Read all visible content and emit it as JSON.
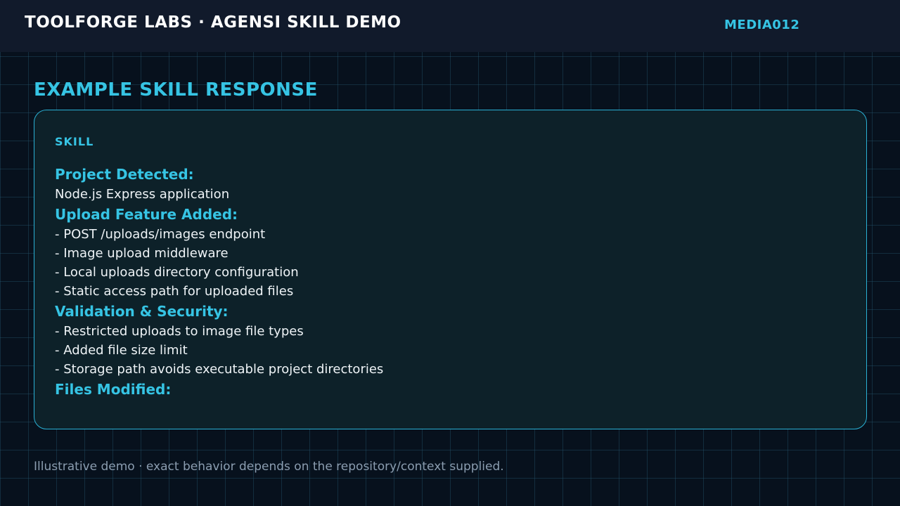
{
  "header": {
    "title": "TOOLFORGE LABS · AGENSI SKILL DEMO",
    "code": "MEDIA012"
  },
  "section": {
    "heading": "EXAMPLE SKILL RESPONSE"
  },
  "card": {
    "label": "SKILL",
    "blocks": [
      {
        "heading": "Project Detected:",
        "lines": [
          "Node.js Express application"
        ]
      },
      {
        "heading": "Upload Feature Added:",
        "lines": [
          "- POST /uploads/images endpoint",
          "- Image upload middleware",
          "- Local uploads directory configuration",
          "- Static access path for uploaded files"
        ]
      },
      {
        "heading": "Validation & Security:",
        "lines": [
          "- Restricted uploads to image file types",
          "- Added file size limit",
          "- Storage path avoids executable project directories"
        ]
      },
      {
        "heading": "Files Modified:",
        "lines": []
      }
    ]
  },
  "footer": {
    "note": "Illustrative demo · exact behavior depends on the repository/context supplied."
  },
  "colors": {
    "background": "#07111d",
    "topbar": "#111a2b",
    "accent": "#36c4e4",
    "card_background": "#0d2129",
    "card_border": "#2ab0d4",
    "body_text": "#eef3f6",
    "muted_text": "#8b9db0"
  }
}
